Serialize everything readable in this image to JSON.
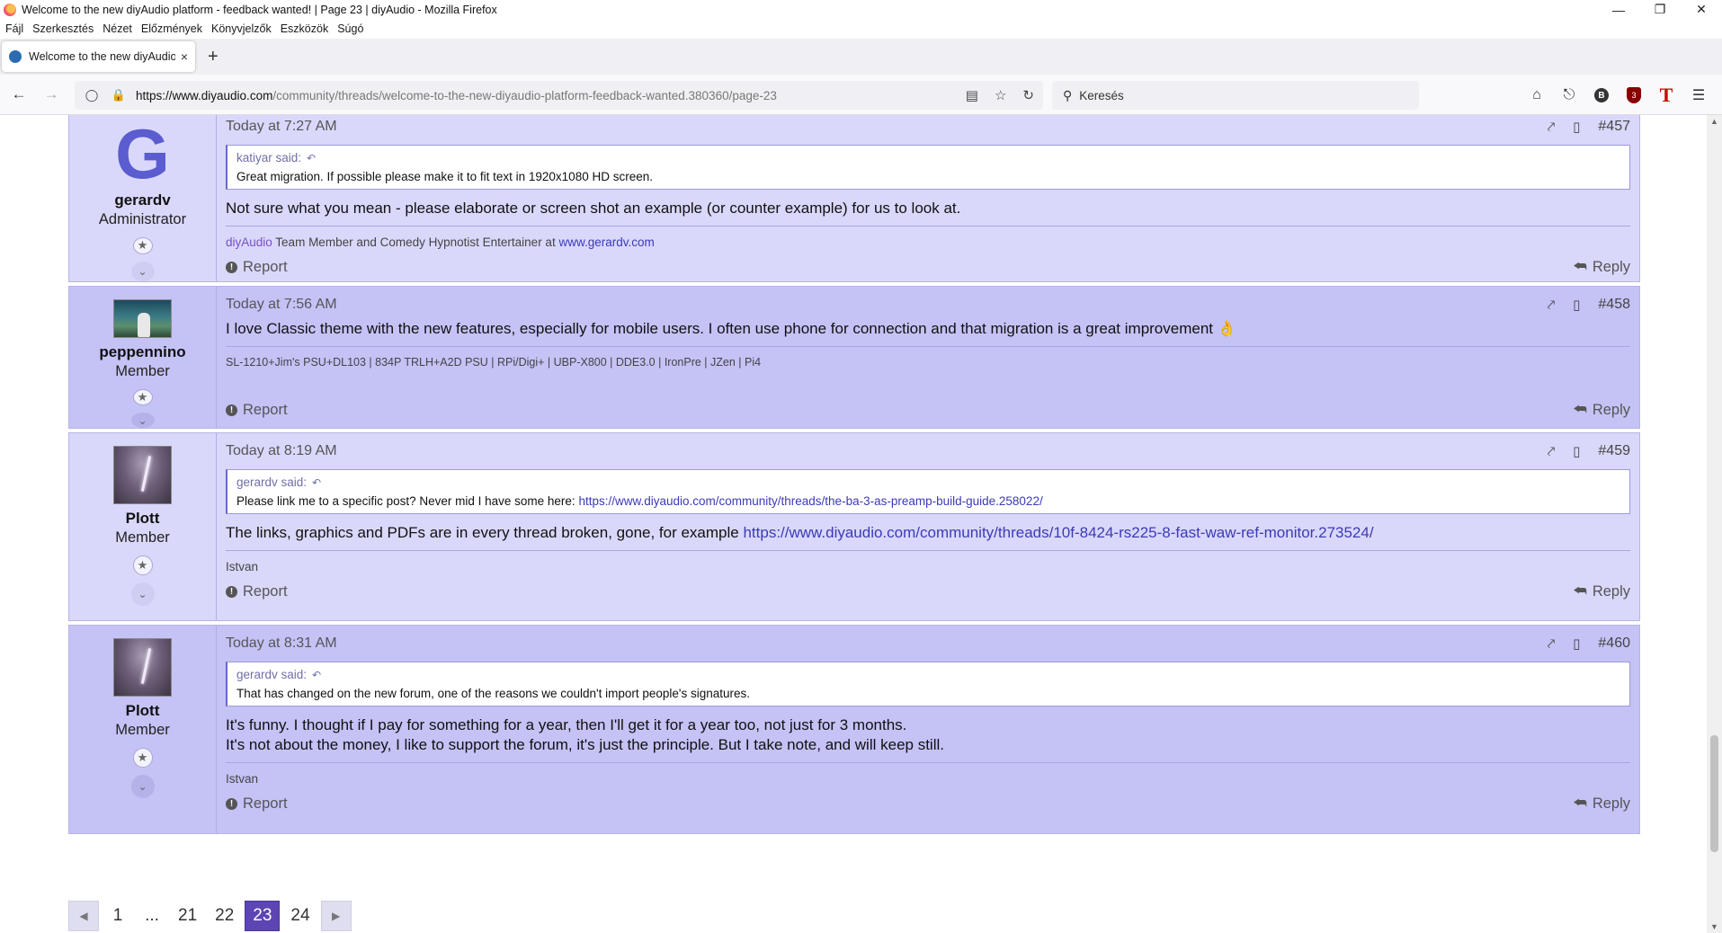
{
  "window": {
    "title": "Welcome to the new diyAudio platform - feedback wanted! | Page 23 | diyAudio - Mozilla Firefox"
  },
  "menu": [
    {
      "label": "Fájl"
    },
    {
      "label": "Szerkesztés"
    },
    {
      "label": "Nézet"
    },
    {
      "label": "Előzmények"
    },
    {
      "label": "Könyvjelzők"
    },
    {
      "label": "Eszközök"
    },
    {
      "label": "Súgó"
    }
  ],
  "tab": {
    "title": "Welcome to the new diyAudio p",
    "close": "×",
    "new_tab": "+"
  },
  "nav": {
    "url_domain": "https://www.diyaudio.com",
    "url_path": "/community/threads/welcome-to-the-new-diyaudio-platform-feedback-wanted.380360/page-23",
    "search_placeholder": "Keresés",
    "ublock_count": "3"
  },
  "posts": [
    {
      "user": {
        "initial": "G",
        "name": "gerardv",
        "title": "Administrator"
      },
      "date": "Today at 7:27 AM",
      "number": "#457",
      "quote": {
        "author": "katiyar said:",
        "text": "Great migration. If possible please make it to fit text in 1920x1080 HD screen.",
        "link": ""
      },
      "body_lines": [
        "Not sure what you mean - please elaborate or screen shot an example (or counter example) for us to look at."
      ],
      "signature": {
        "brand": "diyAudio",
        "text": " Team Member and Comedy Hypnotist Entertainer at ",
        "link": "www.gerardv.com"
      },
      "report": "Report",
      "reply": "Reply"
    },
    {
      "user": {
        "initial": "",
        "name": "peppennino",
        "title": "Member"
      },
      "date": "Today at 7:56 AM",
      "number": "#458",
      "body_lines": [
        "I love Classic theme with the new features, especially for mobile users. I often use phone for connection and that migration is a great improvement 👌"
      ],
      "signature": {
        "brand": "",
        "text": "SL-1210+Jim's PSU+DL103 | 834P TRLH+A2D PSU | RPi/Digi+ | UBP-X800 | DDE3.0 | IronPre | JZen | Pi4",
        "link": ""
      },
      "report": "Report",
      "reply": "Reply"
    },
    {
      "user": {
        "initial": "",
        "name": "Plott",
        "title": "Member"
      },
      "date": "Today at 8:19 AM",
      "number": "#459",
      "quote": {
        "author": "gerardv said:",
        "text": "Please link me to a specific post? Never mid I have some here: ",
        "link": "https://www.diyaudio.com/community/threads/the-ba-3-as-preamp-build-guide.258022/"
      },
      "body_text": "The links, graphics and PDFs are in every thread broken, gone, for example ",
      "body_link": "https://www.diyaudio.com/community/threads/10f-8424-rs225-8-fast-waw-ref-monitor.273524/",
      "signature": {
        "brand": "",
        "text": "Istvan",
        "link": ""
      },
      "report": "Report",
      "reply": "Reply"
    },
    {
      "user": {
        "initial": "",
        "name": "Plott",
        "title": "Member"
      },
      "date": "Today at 8:31 AM",
      "number": "#460",
      "quote": {
        "author": "gerardv said:",
        "text": "That has changed on the new forum, one of the reasons we couldn't import people's signatures.",
        "link": ""
      },
      "body_lines": [
        "It's funny. I thought if I pay for something for a year, then I'll get it for a year too, not just for 3 months.",
        "It's not about the money, I like to support the forum, it's just the principle. But I take note, and will keep still."
      ],
      "signature": {
        "brand": "",
        "text": "Istvan",
        "link": ""
      },
      "report": "Report",
      "reply": "Reply"
    }
  ],
  "pagination": {
    "pages": [
      "1",
      "...",
      "21",
      "22",
      "23",
      "24"
    ],
    "current": "23"
  },
  "icons": {
    "share": "share-icon",
    "bookmark": "bookmark-icon",
    "star": "star-badge-icon",
    "expand": "chevron-down-icon",
    "report": "report-icon",
    "reply": "reply-icon"
  },
  "colors": {
    "post_light": "#d9d8fb",
    "post_dark": "#c5c2f6",
    "accent": "#5d45b3",
    "link": "#3c3ab7"
  }
}
